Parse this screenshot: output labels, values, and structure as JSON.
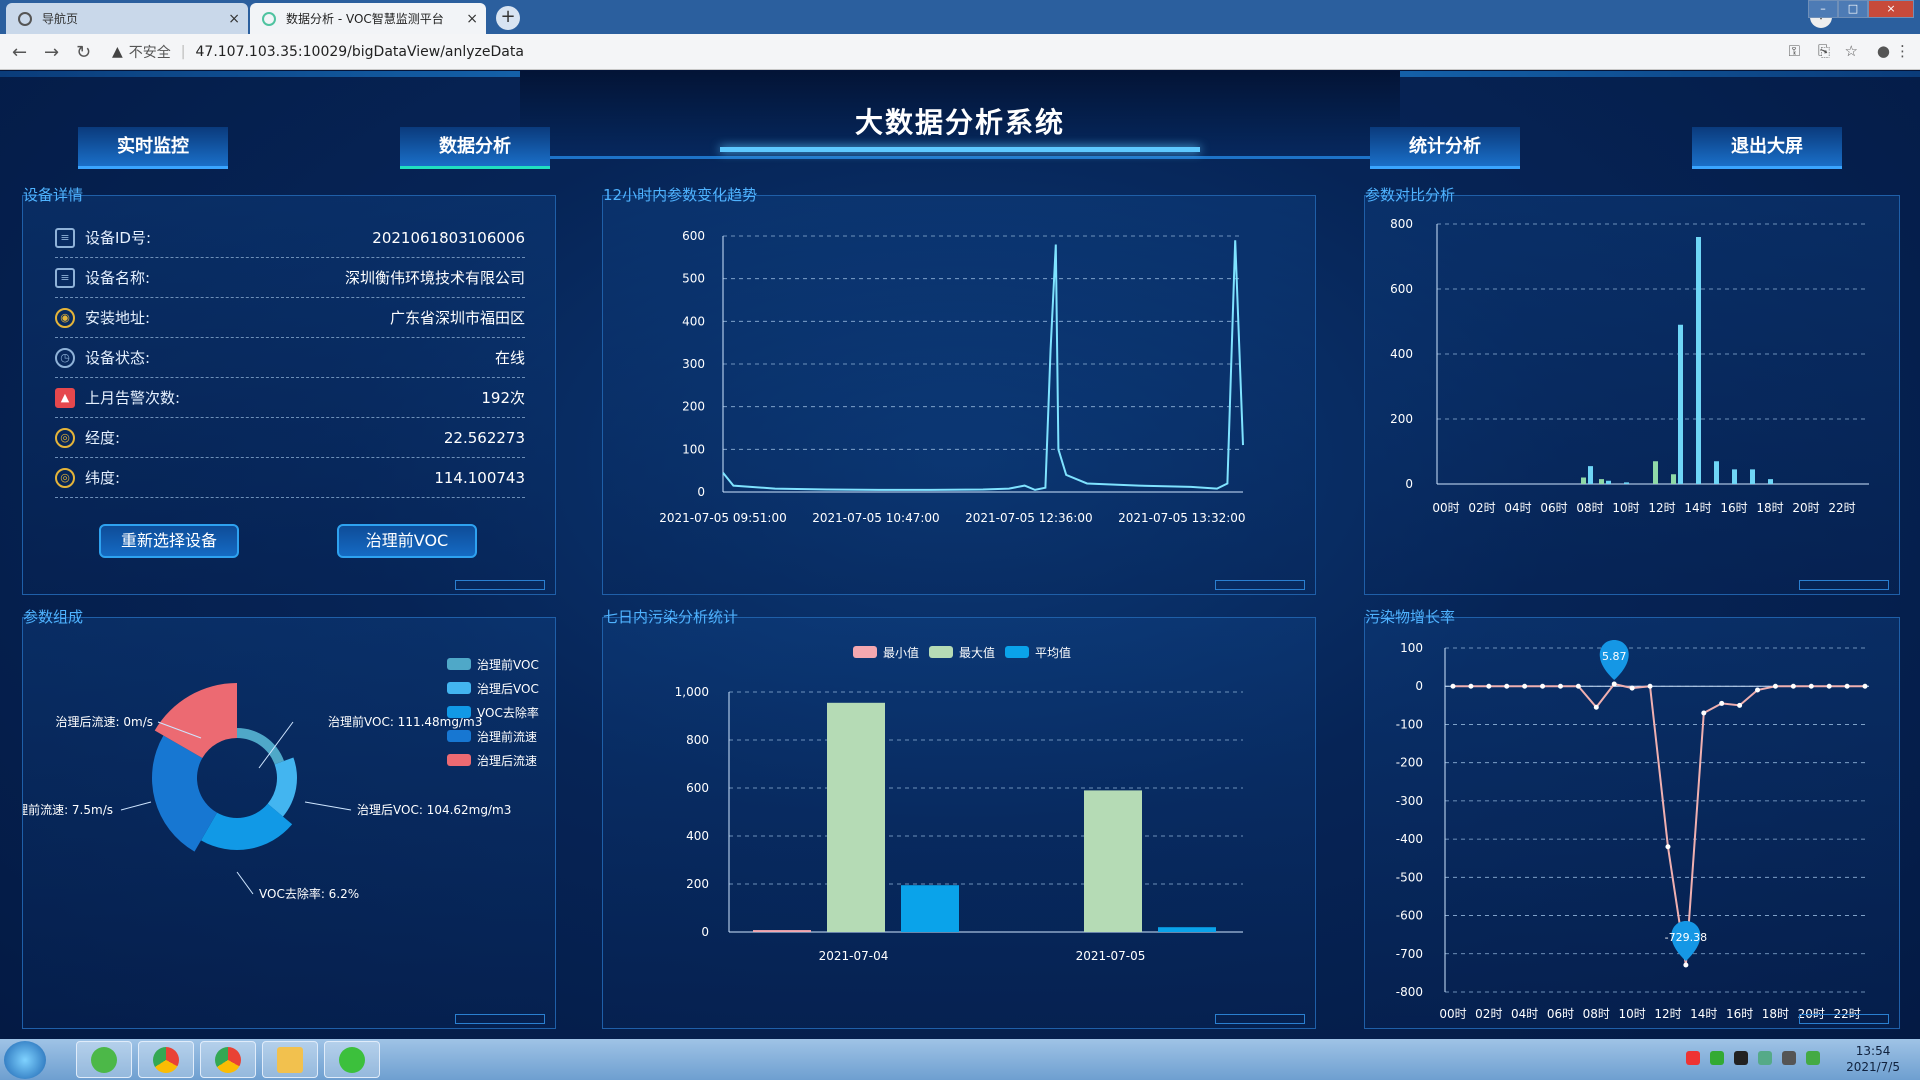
{
  "browser": {
    "tabs": [
      {
        "label": "导航页",
        "close": "×"
      },
      {
        "label": "数据分析 - VOC智慧监测平台",
        "close": "×"
      }
    ],
    "new_tab": "+",
    "nav": {
      "back": "←",
      "forward": "→",
      "reload": "↻"
    },
    "warning_icon": "▲",
    "insecure_label": "不安全",
    "separator": "|",
    "url": "47.107.103.35:10029/bigDataView/anlyzeData"
  },
  "header": {
    "title": "大数据分析系统",
    "nav_buttons": {
      "realtime": "实时监控",
      "analysis": "数据分析",
      "stats": "统计分析",
      "exit": "退出大屏"
    }
  },
  "device": {
    "title": "设备详情",
    "rows": [
      {
        "label": "设备ID号:",
        "value": "2021061803106006"
      },
      {
        "label": "设备名称:",
        "value": "深圳衡伟环境技术有限公司"
      },
      {
        "label": "安装地址:",
        "value": "广东省深圳市福田区"
      },
      {
        "label": "设备状态:",
        "value": "在线"
      },
      {
        "label": "上月告警次数:",
        "value": "192次"
      },
      {
        "label": "经度:",
        "value": "22.562273"
      },
      {
        "label": "纬度:",
        "value": "114.100743"
      }
    ],
    "buttons": {
      "reselect": "重新选择设备",
      "before_voc": "治理前VOC"
    }
  },
  "panels": {
    "trend": "12小时内参数变化趋势",
    "compare": "参数对比分析",
    "composition": "参数组成",
    "seven_day": "七日内污染分析统计",
    "growth": "污染物增长率"
  },
  "chart_data": [
    {
      "type": "line",
      "title": "12小时内参数变化趋势",
      "y_ticks": [
        0,
        100,
        200,
        300,
        400,
        500,
        600
      ],
      "x_tick_labels": [
        "2021-07-05 09:51:00",
        "2021-07-05 10:47:00",
        "2021-07-05 12:36:00",
        "2021-07-05 13:32:00"
      ],
      "ylim": [
        0,
        600
      ],
      "series": [
        {
          "values": [
            [
              0,
              45
            ],
            [
              0.02,
              15
            ],
            [
              0.1,
              8
            ],
            [
              0.2,
              6
            ],
            [
              0.3,
              5
            ],
            [
              0.4,
              5
            ],
            [
              0.5,
              6
            ],
            [
              0.55,
              8
            ],
            [
              0.58,
              15
            ],
            [
              0.6,
              5
            ],
            [
              0.62,
              10
            ],
            [
              0.63,
              335
            ],
            [
              0.64,
              580
            ],
            [
              0.645,
              100
            ],
            [
              0.66,
              40
            ],
            [
              0.7,
              20
            ],
            [
              0.8,
              15
            ],
            [
              0.9,
              12
            ],
            [
              0.95,
              8
            ],
            [
              0.97,
              20
            ],
            [
              0.985,
              590
            ],
            [
              1.0,
              110
            ]
          ],
          "color": "#7fe3ff"
        }
      ]
    },
    {
      "type": "bar",
      "title": "参数对比分析",
      "categories": [
        "00时",
        "01时",
        "02时",
        "03时",
        "04时",
        "05时",
        "06时",
        "07时",
        "08时",
        "09时",
        "10时",
        "11时",
        "12时",
        "13时",
        "14时",
        "15时",
        "16时",
        "17时",
        "18时",
        "19时",
        "20时",
        "21时",
        "22时",
        "23时"
      ],
      "tick_labels": [
        "00时",
        "02时",
        "04时",
        "06时",
        "08时",
        "10时",
        "12时",
        "14时",
        "16时",
        "18时",
        "20时",
        "22时"
      ],
      "ylim": [
        0,
        800
      ],
      "y_ticks": [
        0,
        200,
        400,
        600,
        800
      ],
      "series": [
        {
          "values": [
            0,
            0,
            0,
            0,
            0,
            0,
            0,
            0,
            55,
            10,
            5,
            0,
            0,
            490,
            760,
            70,
            45,
            45,
            15,
            0,
            0,
            0,
            0,
            0
          ],
          "color": "#6fd6f6"
        },
        {
          "values": [
            0,
            0,
            0,
            0,
            0,
            0,
            0,
            0,
            20,
            15,
            0,
            0,
            70,
            30,
            0,
            0,
            0,
            0,
            0,
            0,
            0,
            0,
            0,
            0
          ],
          "color": "#8fd9a8"
        }
      ]
    },
    {
      "type": "pie",
      "title": "参数组成",
      "legend": [
        "治理前VOC",
        "治理后VOC",
        "VOC去除率",
        "治理前流速",
        "治理后流速"
      ],
      "slices": [
        {
          "name": "治理前VOC",
          "value": 111.48,
          "color": "#4fa8c8"
        },
        {
          "name": "治理后VOC",
          "value": 104.62,
          "color": "#43b5f0"
        },
        {
          "name": "VOC去除率",
          "value": 6.2,
          "color": "#1199e6"
        },
        {
          "name": "治理前流速",
          "value": 7.5,
          "color": "#1777d2"
        },
        {
          "name": "治理后流速",
          "value": 0,
          "color": "#ec6a72"
        }
      ],
      "labels": [
        "治理后流速: 0m/s",
        "治理前VOC: 111.48mg/m3",
        "治理后VOC: 104.62mg/m3",
        "VOC去除率: 6.2%",
        "治理前流速: 7.5m/s"
      ]
    },
    {
      "type": "bar",
      "title": "七日内污染分析统计",
      "categories": [
        "2021-07-04",
        "2021-07-05"
      ],
      "ylim": [
        0,
        1000
      ],
      "y_ticks": [
        0,
        200,
        400,
        600,
        800,
        1000
      ],
      "y_tick_labels": [
        "0",
        "200",
        "400",
        "600",
        "800",
        "1,000"
      ],
      "series": [
        {
          "name": "最小值",
          "values": [
            8,
            0
          ],
          "color": "#f4a8b0"
        },
        {
          "name": "最大值",
          "values": [
            955,
            590
          ],
          "color": "#b5dbb5"
        },
        {
          "name": "平均值",
          "values": [
            195,
            20
          ],
          "color": "#0aa3ea"
        }
      ]
    },
    {
      "type": "line",
      "title": "污染物增长率",
      "x_tick_labels": [
        "00时",
        "02时",
        "04时",
        "06时",
        "08时",
        "10时",
        "12时",
        "14时",
        "16时",
        "18时",
        "20时",
        "22时"
      ],
      "ylim": [
        -800,
        100
      ],
      "y_ticks": [
        100,
        0,
        -100,
        -200,
        -300,
        -400,
        -500,
        -600,
        -700,
        -800
      ],
      "series": [
        {
          "values": [
            0,
            0,
            0,
            0,
            0,
            0,
            0,
            0,
            -55,
            5.87,
            -5,
            0,
            -420,
            -729.38,
            -70,
            -45,
            -50,
            -10,
            0,
            0,
            0,
            0,
            0,
            0
          ],
          "color": "#f0b0b0"
        }
      ],
      "markers": [
        {
          "label": "5.87",
          "index": 9
        },
        {
          "label": "-729.38",
          "index": 13
        }
      ]
    }
  ],
  "taskbar": {
    "time": "13:54",
    "date": "2021/7/5"
  }
}
